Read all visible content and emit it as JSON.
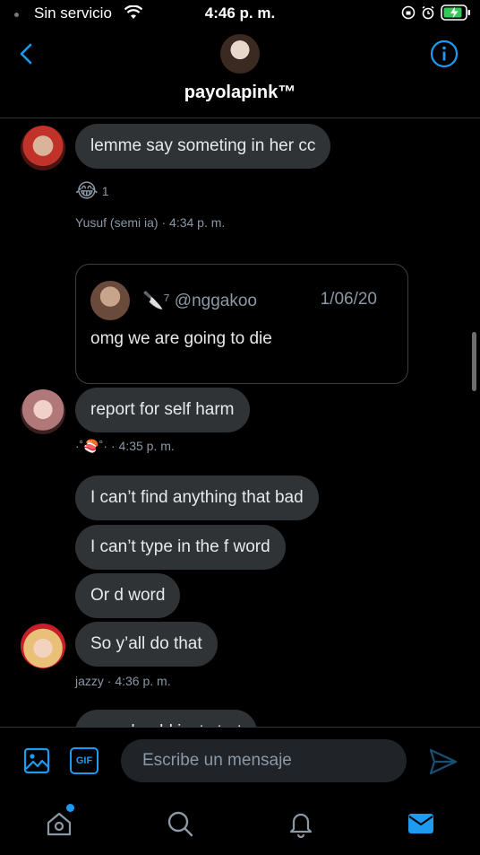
{
  "status_bar": {
    "carrier": "Sin servicio",
    "time": "4:46 p. m."
  },
  "header": {
    "title": "payolapink™"
  },
  "messages": [
    {
      "text": "lemme say someting in her cc"
    },
    {
      "reaction_emoji": "😂",
      "reaction_count": "1"
    },
    {
      "meta": "Yusuf (semi ia)  · 4:34 p. m."
    },
    {
      "text": "report for self harm"
    },
    {
      "meta_name": "·˚🍣˚·",
      "meta_time": " · 4:35 p. m."
    },
    {
      "text": "I can’t find anything that bad"
    },
    {
      "text": "I can’t type in the f word"
    },
    {
      "text": "Or d word"
    },
    {
      "text": "So y’all do that"
    },
    {
      "meta": "jazzy  · 4:36 p. m."
    },
    {
      "text": "you should just start"
    }
  ],
  "quote": {
    "name": "🔪⁷ @nggakoo",
    "date": "1/06/20",
    "text": "omg we are going to die"
  },
  "composer": {
    "gif_label": "GIF",
    "placeholder": "Escribe un mensaje"
  },
  "colors": {
    "accent": "#1d9bf0",
    "bubble": "#2f3336",
    "muted": "#8b98a5"
  },
  "icons": [
    "back-icon",
    "info-icon",
    "media-icon",
    "send-icon",
    "home-icon",
    "search-icon",
    "bell-icon",
    "mail-icon"
  ]
}
